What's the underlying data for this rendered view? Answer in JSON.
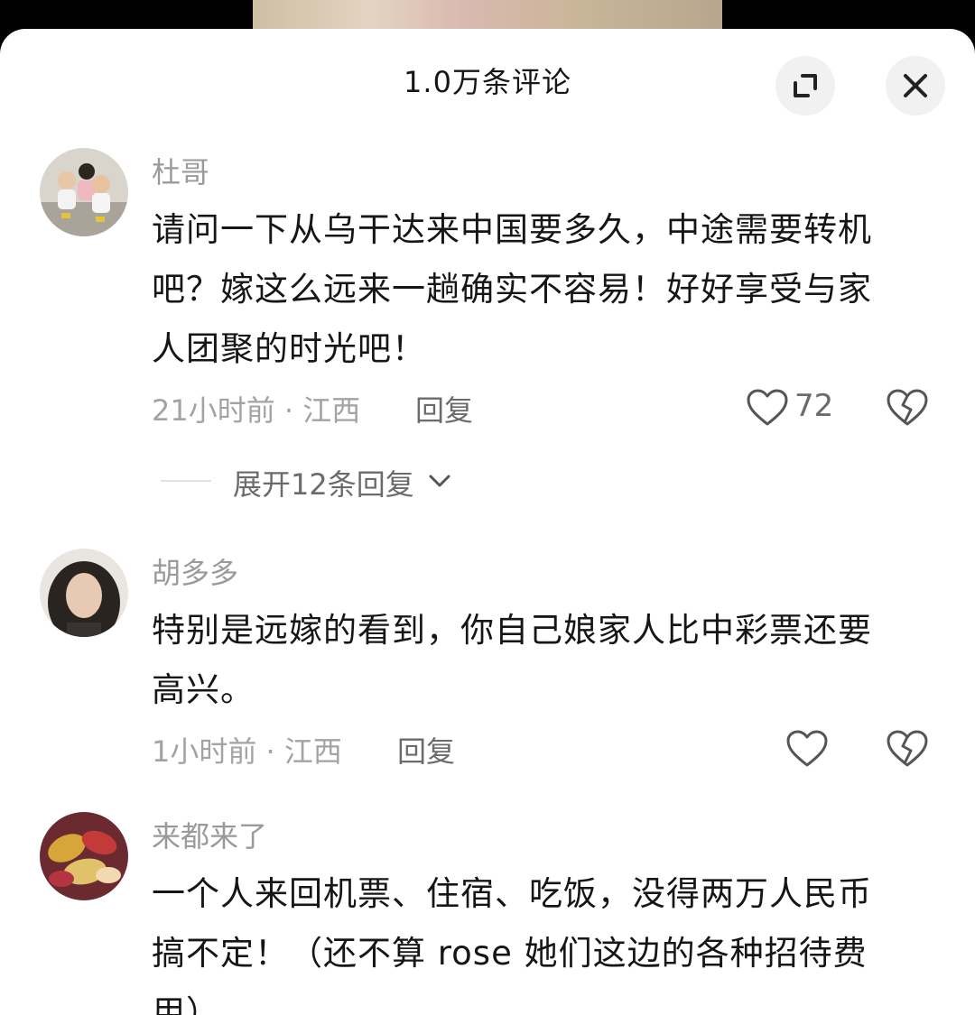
{
  "header": {
    "title": "1.0万条评论",
    "expand_icon": "expand-icon",
    "close_icon": "close-icon"
  },
  "comments": [
    {
      "username": "杜哥",
      "avatar": "avatar-children-photo",
      "lines": [
        "请问一下从乌干达来中国要多久，中途需要转机",
        "吧？嫁这么远来一趟确实不容易！好好享受与家",
        "人团聚的时光吧！"
      ],
      "time_location": "21小时前 · 江西",
      "reply_label": "回复",
      "like_count": "72",
      "expand_replies_label": "展开12条回复"
    },
    {
      "username": "胡多多",
      "avatar": "avatar-woman-photo",
      "lines": [
        "特别是远嫁的看到，你自己娘家人比中彩票还要",
        "高兴。"
      ],
      "time_location": "1小时前 · 江西",
      "reply_label": "回复"
    },
    {
      "username": "来都来了",
      "avatar": "avatar-candy-photo",
      "lines": [
        "一个人来回机票、住宿、吃饭，没得两万人民币",
        "搞不定！（还不算 rose 她们这边的各种招待费",
        "用）"
      ]
    }
  ],
  "colors": {
    "sheet_background": "#ffffff",
    "primary_text": "#161616",
    "secondary_text": "#a3a3a3",
    "icon_button_bg": "#f1f1f1"
  }
}
